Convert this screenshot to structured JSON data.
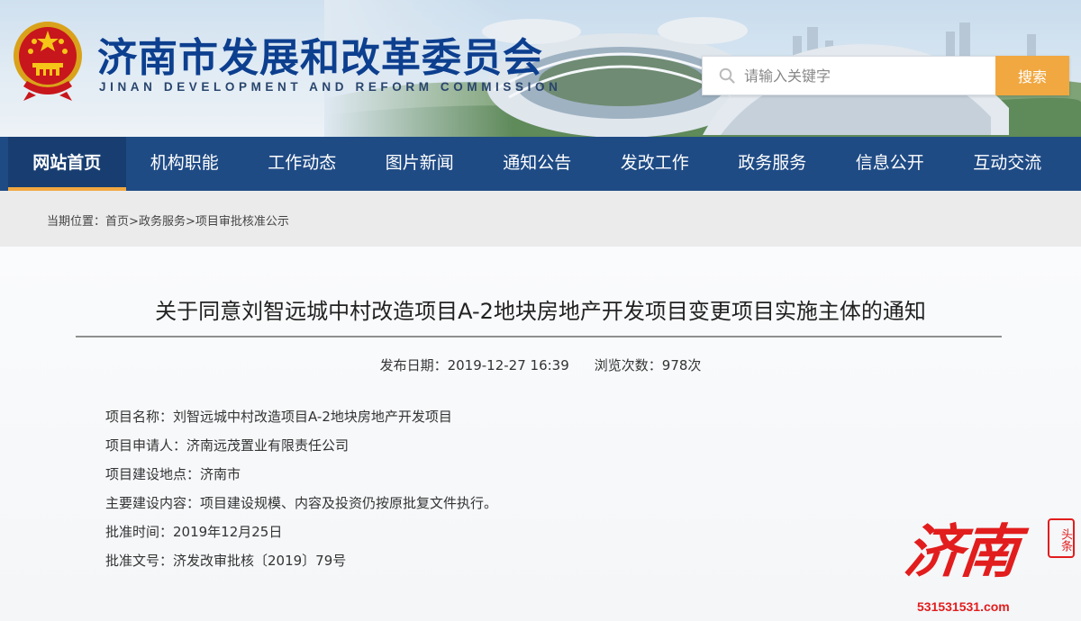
{
  "header": {
    "title": "济南市发展和改革委员会",
    "subtitle": "JINAN DEVELOPMENT AND REFORM COMMISSION",
    "search_placeholder": "请输入关键字",
    "search_button": "搜索"
  },
  "nav": {
    "items": [
      {
        "label": "网站首页",
        "active": true
      },
      {
        "label": "机构职能"
      },
      {
        "label": "工作动态"
      },
      {
        "label": "图片新闻"
      },
      {
        "label": "通知公告"
      },
      {
        "label": "发改工作"
      },
      {
        "label": "政务服务"
      },
      {
        "label": "信息公开"
      },
      {
        "label": "互动交流"
      }
    ]
  },
  "breadcrumb": {
    "prefix": "当期位置：",
    "items": [
      "首页",
      "政务服务",
      "项目审批核准公示"
    ],
    "separator": ">"
  },
  "article": {
    "title": "关于同意刘智远城中村改造项目A-2地块房地产开发项目变更项目实施主体的通知",
    "publish_label": "发布日期：",
    "publish_date": "2019-12-27 16:39",
    "views_label": "浏览次数：",
    "views": "978次",
    "lines": [
      "项目名称：刘智远城中村改造项目A-2地块房地产开发项目",
      "项目申请人：济南远茂置业有限责任公司",
      "项目建设地点：济南市",
      "主要建设内容：项目建设规模、内容及投资仍按原批复文件执行。",
      "批准时间：2019年12月25日",
      "批准文号：济发改审批核〔2019〕79号"
    ]
  },
  "watermark": {
    "text": "济南",
    "seal": "头条",
    "url": "531531531.com"
  },
  "colors": {
    "nav_bg": "#1f4b85",
    "nav_active_bg": "#183e71",
    "accent": "#f1a841",
    "title_blue": "#0d3f8f",
    "watermark_red": "#e21d1d"
  }
}
